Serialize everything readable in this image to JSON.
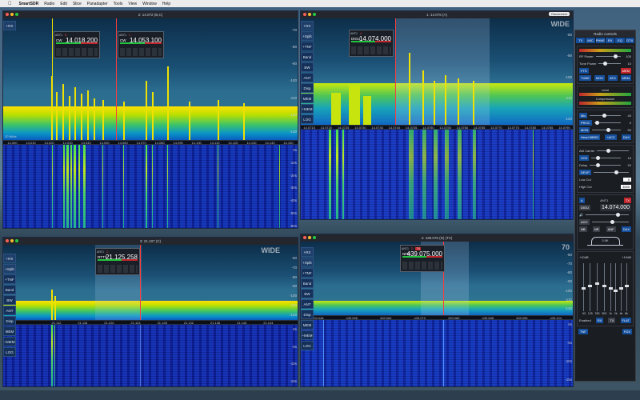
{
  "menubar": {
    "app": "SmartSDR",
    "items": [
      "Radio",
      "Edit",
      "Slice",
      "Panadapter",
      "Tools",
      "View",
      "Window",
      "Help"
    ]
  },
  "panels": {
    "p1": {
      "title": "2: 14.072 (B,C)",
      "filter": "20 Wide",
      "db": [
        "-70",
        "-80",
        "-90",
        "-100",
        "-110",
        "-120",
        "-130"
      ],
      "freq_scale": [
        "14.000",
        "14.010",
        "14.020",
        "14.030",
        "14.040",
        "14.050",
        "14.060",
        "14.070",
        "14.080",
        "14.090",
        "14.100",
        "14.110",
        "14.120",
        "14.130",
        "14.140",
        "14.150"
      ],
      "wf_scale": [
        "0s",
        "-10s",
        "-20s",
        "-30s",
        "-40s",
        "-50s",
        "-60s"
      ],
      "flag_b": {
        "ant": "ANT1",
        "tag": "B",
        "mode": "CW",
        "freq": "14.018.200"
      },
      "flag_c": {
        "ant": "ANT1",
        "tag": "C",
        "mode": "CW",
        "freq": "14.053.100"
      }
    },
    "p2": {
      "title": "1: 14.076 (A)",
      "wide": "WIDE",
      "disconnect": "Disconnect",
      "db": [
        "-80",
        "-90",
        "-100",
        "-110",
        "-120"
      ],
      "freq_scale": [
        "14.0715",
        "14.0720",
        "14.0725",
        "14.0730",
        "14.0735",
        "14.0740",
        "14.0745",
        "14.0750",
        "14.0755",
        "14.0760",
        "14.0765",
        "14.0770",
        "14.0775",
        "14.0780",
        "14.0785",
        "14.0790"
      ],
      "flag_a": {
        "ant": "ANT1",
        "tag": "A",
        "mode": "DIGU",
        "freq": "14.074.000"
      }
    },
    "p3": {
      "title": "3: 21.107 (C)",
      "wide": "WIDE",
      "db": [
        "-60",
        "-70",
        "-80",
        "-90",
        "-100",
        "-110",
        "-120"
      ],
      "freq_scale": [
        "21.112",
        "21.116",
        "21.120",
        "21.124",
        "21.128",
        "21.132",
        "21.136",
        "21.140",
        "21.144"
      ],
      "wf_scale": [
        "0s",
        "-5s",
        "-10s",
        "-15s"
      ],
      "flag": {
        "ant": "ANT1",
        "tag": "C",
        "mode": "RTTY",
        "freq": "21.125.258"
      }
    },
    "p4": {
      "title": "4: 439.076 (D) (TX)",
      "wide": "70",
      "db": [
        "-60",
        "-70",
        "-80",
        "-90",
        "-100",
        "-110",
        "-120"
      ],
      "freq_scale": [
        "439.048",
        "439.056",
        "439.064",
        "439.072",
        "439.080",
        "439.088",
        "439.096",
        "439.104"
      ],
      "wf_scale": [
        "0s",
        "-5s",
        "-10s",
        "-15s"
      ],
      "flag": {
        "ant": "ANT1",
        "tag": "D",
        "mode": "NFM",
        "freq": "439.075.000",
        "tx": "TX"
      }
    }
  },
  "sidebar": [
    "+RX",
    "+TNF",
    "Band",
    "ANT",
    "BW",
    "Disp",
    "MEM",
    "+MEM",
    "LOG"
  ],
  "sidebar3": [
    "+RX",
    "+Split",
    "+TNF",
    "Band",
    "BW",
    "ANT",
    "Disp",
    "MEM",
    "+MEM",
    "LOG"
  ],
  "controls": {
    "title": "Radio controls",
    "tabs": [
      "TX",
      "MIC",
      "PHNE",
      "RX",
      "EQ",
      "DTX"
    ],
    "tx": {
      "rf_power": "RF Power",
      "tune_power": "Tune Power",
      "rf_val": "100",
      "tune_val": "10",
      "atu": "ATU",
      "mem": "MEM",
      "tune": "TUNE",
      "mox": "MOX",
      "fts": "FTS"
    },
    "meters": {
      "level": "Level",
      "compression": "Compression"
    },
    "mic": {
      "mic": "Mic",
      "proc": "PROC",
      "mon": "MON",
      "mic_val": "40",
      "proc_val": "0",
      "mon_val": "50",
      "hmd": "Head MBSD",
      "acc": "+ACC",
      "dax": "DAX"
    },
    "phone": {
      "vox": "VOX",
      "delay": "Delay",
      "dexp": "DEXP",
      "lowcut": "Low Cut",
      "highcut": "High Cut",
      "vox_val": "15",
      "delay_val": "20",
      "lowcut_val": "0",
      "highcut_val": "3000",
      "am_carrier": "AM Carrier"
    },
    "slice": {
      "tag": "A",
      "ant": "ANT1",
      "tx": "TX",
      "mode": "DIGU",
      "freq": "14.074.000"
    },
    "rx": {
      "agc": "AGC",
      "nb": "NB",
      "nr": "NR",
      "anf": "ANF",
      "dax": "DAX",
      "bw": "3.0K"
    },
    "eq": {
      "labels": [
        "63",
        "125",
        "250",
        "500",
        "1k",
        "2k",
        "4k",
        "8k"
      ],
      "top": "+10dB",
      "bot": "-10dB",
      "enabled": "Enabled",
      "rx": "RX",
      "tx": "TX",
      "flat": "FLAT"
    },
    "bottom": {
      "tnf": "TNF",
      "fdx": "FDX"
    }
  }
}
